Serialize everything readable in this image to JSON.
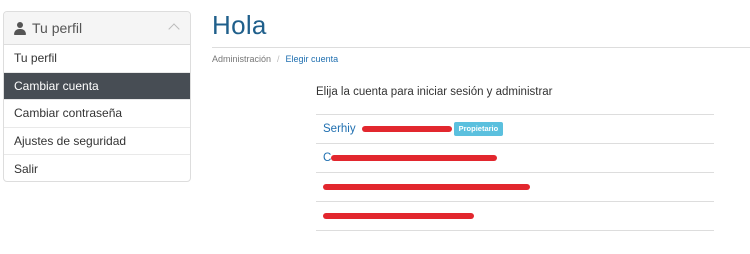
{
  "sidebar": {
    "header": {
      "title": "Tu perfil",
      "icon": "user-icon"
    },
    "items": [
      {
        "label": "Tu perfil"
      },
      {
        "label": "Cambiar cuenta"
      },
      {
        "label": "Cambiar contraseña"
      },
      {
        "label": "Ajustes de seguridad"
      },
      {
        "label": "Salir"
      }
    ],
    "active_label": "Cambiar cuenta"
  },
  "main": {
    "title": "Hola",
    "breadcrumb": {
      "items": [
        "Administración",
        "Elegir cuenta"
      ],
      "separator": "/"
    },
    "prompt": "Elija la cuenta para iniciar sesión y administrar",
    "accounts": [
      {
        "name": "Serhiy",
        "badge": "Propietario"
      },
      {
        "name": "C"
      },
      {
        "name": ""
      },
      {
        "name": ""
      }
    ]
  },
  "colors": {
    "active_bg": "#474d54",
    "title": "#1f5f8b",
    "link": "#1f6fb0",
    "badge": "#5bc0de",
    "redaction": "#e0151c"
  }
}
